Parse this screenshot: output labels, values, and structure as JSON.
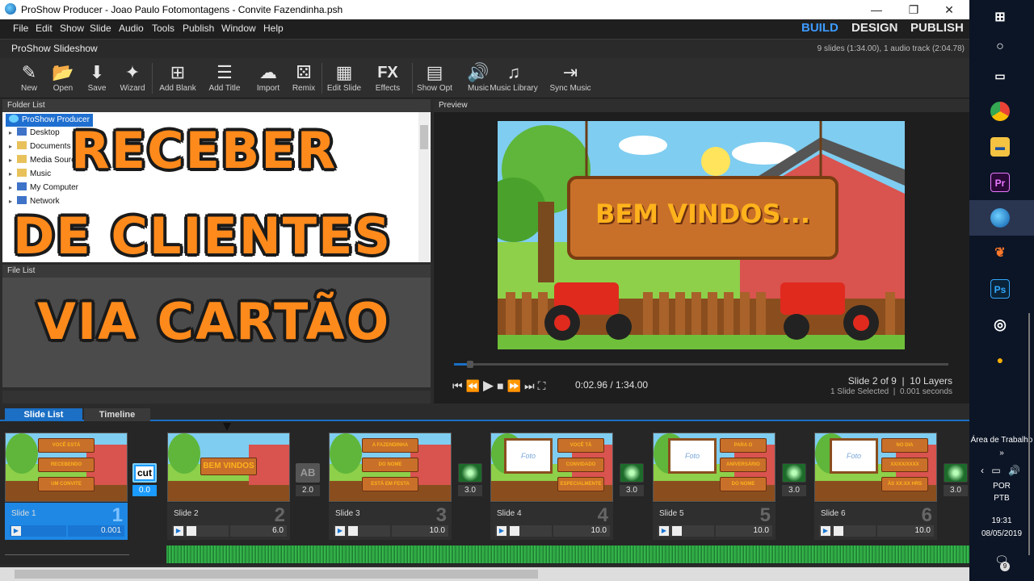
{
  "window": {
    "title": "ProShow Producer - Joao Paulo Fotomontagens - Convite Fazendinha.psh",
    "minimize": "—",
    "maximize": "❐",
    "close": "✕"
  },
  "menu": [
    "File",
    "Edit",
    "Show",
    "Slide",
    "Audio",
    "Tools",
    "Publish",
    "Window",
    "Help"
  ],
  "modes": {
    "build": "BUILD",
    "design": "DESIGN",
    "publish": "PUBLISH"
  },
  "show": {
    "name": "ProShow Slideshow",
    "summary": "9 slides (1:34.00), 1 audio track (2:04.78)"
  },
  "toolbar": [
    {
      "label": "New",
      "icon": "new-icon",
      "glyph": "✎"
    },
    {
      "label": "Open",
      "icon": "open-folder-icon",
      "glyph": "📂"
    },
    {
      "label": "Save",
      "icon": "save-icon",
      "glyph": "⬇"
    },
    {
      "label": "Wizard",
      "icon": "wizard-icon",
      "glyph": "✦"
    },
    {
      "label": "Add Blank",
      "icon": "add-blank-icon",
      "glyph": "⊞"
    },
    {
      "label": "Add Title",
      "icon": "add-title-icon",
      "glyph": "☰"
    },
    {
      "label": "Import",
      "icon": "import-cloud-icon",
      "glyph": "☁"
    },
    {
      "label": "Remix",
      "icon": "remix-icon",
      "glyph": "⚄"
    },
    {
      "label": "Edit Slide",
      "icon": "edit-slide-icon",
      "glyph": "▦"
    },
    {
      "label": "Effects",
      "icon": "effects-icon",
      "glyph": "FX"
    },
    {
      "label": "Show Opt",
      "icon": "show-options-icon",
      "glyph": "▤"
    },
    {
      "label": "Music",
      "icon": "music-speaker-icon",
      "glyph": "🔊"
    },
    {
      "label": "Music Library",
      "icon": "music-library-icon",
      "glyph": "♫"
    },
    {
      "label": "Sync Music",
      "icon": "sync-music-icon",
      "glyph": "⇥"
    }
  ],
  "folder_list": {
    "header": "Folder List",
    "root": "ProShow Producer",
    "items": [
      "Desktop",
      "Documents",
      "Media Sources",
      "Music",
      "My Computer",
      "Network"
    ]
  },
  "file_list": {
    "header": "File List"
  },
  "preview": {
    "header": "Preview",
    "sign_text": "BEM VINDOS...",
    "time": "0:02.96 / 1:34.00",
    "slide_info": "Slide 2 of 9  |  10 Layers",
    "selection_info": "1 Slide Selected  |  0.001 seconds",
    "progress": 0.032
  },
  "overlay": {
    "line1": "RECEBER",
    "line2": "DE CLIENTES",
    "line3": "VIA CARTÃO"
  },
  "tabs": {
    "slide_list": "Slide List",
    "timeline": "Timeline"
  },
  "slides": [
    {
      "name": "Slide 1",
      "num": "1",
      "duration": "0.001",
      "selected": true,
      "signs": [
        "VOCÊ ESTÁ",
        "RECEBENDO",
        "UM CONVITE"
      ]
    },
    {
      "name": "Slide 2",
      "num": "2",
      "duration": "6.0",
      "selected": false,
      "signs": [
        "BEM VINDOS"
      ]
    },
    {
      "name": "Slide 3",
      "num": "3",
      "duration": "10.0",
      "selected": false,
      "signs": [
        "A FAZENDINHA",
        "DO NOME",
        "ESTÁ EM FESTA"
      ]
    },
    {
      "name": "Slide 4",
      "num": "4",
      "duration": "10.0",
      "selected": false,
      "signs": [
        "VOCÊ TÁ",
        "CONVIDADO",
        "ESPECIALMENTE"
      ]
    },
    {
      "name": "Slide 5",
      "num": "5",
      "duration": "10.0",
      "selected": false,
      "signs": [
        "PARA O",
        "ANIVERSÁRIO",
        "DO NOME"
      ]
    },
    {
      "name": "Slide 6",
      "num": "6",
      "duration": "10.0",
      "selected": false,
      "signs": [
        "NO DIA",
        "XX/XX/XXXX",
        "ÀS XX:XX HRS"
      ]
    }
  ],
  "transitions": [
    {
      "label": "cut",
      "duration": "0.0",
      "type": "cut"
    },
    {
      "label": "AB",
      "duration": "2.0",
      "type": "ab"
    },
    {
      "label": "",
      "duration": "3.0",
      "type": "sparkle"
    },
    {
      "label": "",
      "duration": "3.0",
      "type": "sparkle"
    },
    {
      "label": "",
      "duration": "3.0",
      "type": "sparkle"
    },
    {
      "label": "",
      "duration": "3.0",
      "type": "sparkle"
    }
  ],
  "photo_label": "Foto",
  "taskbar": {
    "desktop_label": "Área de Trabalho",
    "lang1": "POR",
    "lang2": "PTB",
    "time": "19:31",
    "date": "08/05/2019",
    "notifications": "9"
  },
  "colors": {
    "accent": "#1b6fc4",
    "overlay_orange": "#ff8a1c",
    "sign_wood": "#c8702a",
    "sign_text": "#ffb21c"
  }
}
